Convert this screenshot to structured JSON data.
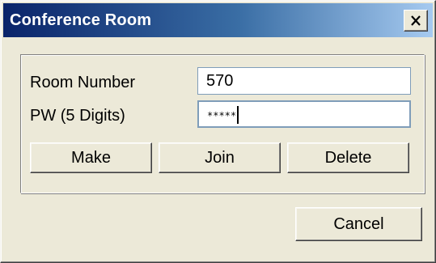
{
  "window": {
    "title": "Conference Room",
    "close_symbol": "×"
  },
  "form": {
    "room_number_label": "Room Number",
    "room_number_value": "570",
    "password_label": "PW (5 Digits)",
    "password_mask": "*****"
  },
  "buttons": {
    "make": "Make",
    "join": "Join",
    "delete": "Delete",
    "cancel": "Cancel"
  },
  "colors": {
    "titlebar_start": "#0a246a",
    "titlebar_end": "#a6caf0",
    "dialog_face": "#ece9d8",
    "input_border": "#7f9db9"
  }
}
